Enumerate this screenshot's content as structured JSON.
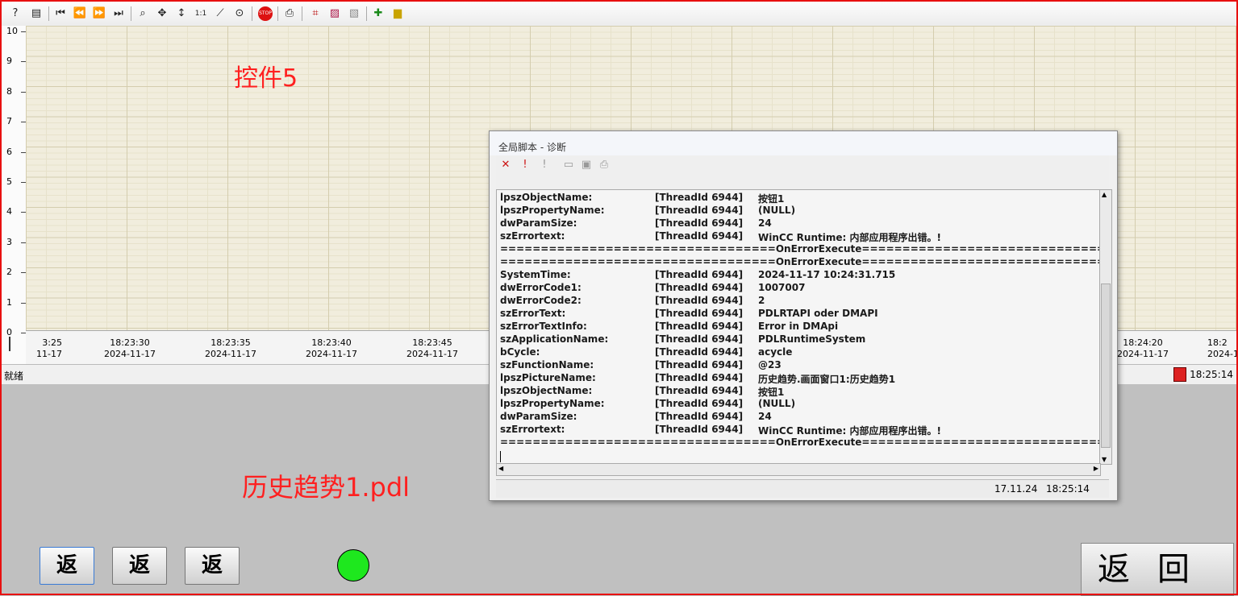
{
  "trend": {
    "overlay_label": "控件5",
    "y_ticks": [
      "10",
      "9",
      "8",
      "7",
      "6",
      "5",
      "4",
      "3",
      "2",
      "1",
      "0"
    ],
    "x_ticks": [
      {
        "time": "3:25",
        "date": "11-17"
      },
      {
        "time": "18:23:30",
        "date": "2024-11-17"
      },
      {
        "time": "18:23:35",
        "date": "2024-11-17"
      },
      {
        "time": "18:23:40",
        "date": "2024-11-17"
      },
      {
        "time": "18:23:45",
        "date": "2024-11-17"
      },
      {
        "time": "18:24:20",
        "date": "2024-11-17"
      },
      {
        "time": "18:2",
        "date": "2024-1"
      }
    ],
    "status_text": "就绪",
    "status_time": "18:25:14",
    "toolbar_icons": [
      "help-icon",
      "table-icon",
      "first-icon",
      "rewind-icon",
      "forward-icon",
      "last-icon",
      "zoom-icon",
      "move-icon",
      "zoom-vert-icon",
      "one-to-one-icon",
      "trend-zoom-icon",
      "original-icon",
      "stop-icon",
      "print-icon",
      "select-data-icon",
      "select-trend-icon",
      "config-icon",
      "add-icon",
      "export-icon"
    ]
  },
  "picture": {
    "label": "历史趋势1.pdl",
    "buttons": [
      "返",
      "返",
      "返"
    ],
    "back_label": "返回",
    "lamp_color": "#1ee81e"
  },
  "diag": {
    "title": "全局脚本 - 诊断",
    "date": "17.11.24",
    "time": "18:25:14",
    "separator_label": "OnErrorExecute",
    "rows": [
      {
        "k": "lpszObjectName:",
        "t": "[ThreadId 6944]",
        "v": "按钮1"
      },
      {
        "k": "lpszPropertyName:",
        "t": "[ThreadId 6944]",
        "v": "(NULL)"
      },
      {
        "k": "dwParamSize:",
        "t": "[ThreadId 6944]",
        "v": "24"
      },
      {
        "k": "szErrortext:",
        "t": "[ThreadId 6944]",
        "v": "WinCC Runtime: 内部应用程序出错。!"
      },
      {
        "sep": "==================================OnErrorExecute=================================="
      },
      {
        "sep": "==================================OnErrorExecute=================================="
      },
      {
        "k": "SystemTime:",
        "t": "[ThreadId 6944]",
        "v": "2024-11-17 10:24:31.715"
      },
      {
        "k": "dwErrorCode1:",
        "t": "[ThreadId 6944]",
        "v": "1007007"
      },
      {
        "k": "dwErrorCode2:",
        "t": "[ThreadId 6944]",
        "v": "2"
      },
      {
        "k": "szErrorText:",
        "t": "[ThreadId 6944]",
        "v": "PDLRTAPI oder DMAPI"
      },
      {
        "k": "szErrorTextInfo:",
        "t": "[ThreadId 6944]",
        "v": "Error in DMApi"
      },
      {
        "k": "szApplicationName:",
        "t": "[ThreadId 6944]",
        "v": "PDLRuntimeSystem"
      },
      {
        "k": "bCycle:",
        "t": "[ThreadId 6944]",
        "v": "acycle"
      },
      {
        "k": "szFunctionName:",
        "t": "[ThreadId 6944]",
        "v": "@23"
      },
      {
        "k": "lpszPictureName:",
        "t": "[ThreadId 6944]",
        "v": "历史趋势.画面窗口1:历史趋势1"
      },
      {
        "k": "lpszObjectName:",
        "t": "[ThreadId 6944]",
        "v": "按钮1"
      },
      {
        "k": "lpszPropertyName:",
        "t": "[ThreadId 6944]",
        "v": "(NULL)"
      },
      {
        "k": "dwParamSize:",
        "t": "[ThreadId 6944]",
        "v": "24"
      },
      {
        "k": "szErrortext:",
        "t": "[ThreadId 6944]",
        "v": "WinCC Runtime: 内部应用程序出错。!"
      },
      {
        "sep": "==================================OnErrorExecute=================================="
      }
    ]
  },
  "colors": {
    "frame": "#e81010",
    "label_red": "#ff2020",
    "plot_bg": "#f1eddd"
  }
}
